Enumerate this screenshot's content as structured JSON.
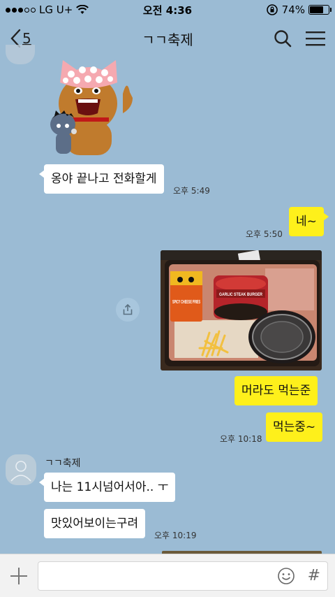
{
  "status_bar": {
    "carrier": "LG U+",
    "time": "오전 4:36",
    "battery": "74%",
    "battery_level": 0.74,
    "signal_bars_filled": 3,
    "signal_bars_total": 5
  },
  "header": {
    "back_count": "5",
    "title": "ㄱㄱ축제",
    "icons": [
      "chevron-left-icon",
      "search-icon",
      "menu-icon"
    ]
  },
  "messages": {
    "m1": {
      "text": "옹야 끝나고 전화할게",
      "time": "오후 5:49"
    },
    "m2": {
      "text": "네~",
      "time": "오후 5:50"
    },
    "m3": {
      "text": "머라도 먹는준"
    },
    "m4": {
      "text": "먹는중~",
      "time": "오후 10:18"
    },
    "sender_name": "ㄱㄱ축제",
    "m5": {
      "text": "나는 11시넘어서아.. ㅜ"
    },
    "m6": {
      "text": "맛있어보이는구려",
      "time": "오후 10:19"
    },
    "photo_labels": {
      "fries_box": "SPICY CHEESE FRIES",
      "burger_box": "GARLIC STEAK BURGER"
    }
  },
  "input": {
    "value": "",
    "icons": [
      "plus-icon",
      "emoji-icon",
      "hashtag-icon"
    ],
    "hash_symbol": "#"
  },
  "colors": {
    "background": "#9bbbd4",
    "outgoing_bubble": "#fef01b",
    "incoming_bubble": "#ffffff"
  }
}
